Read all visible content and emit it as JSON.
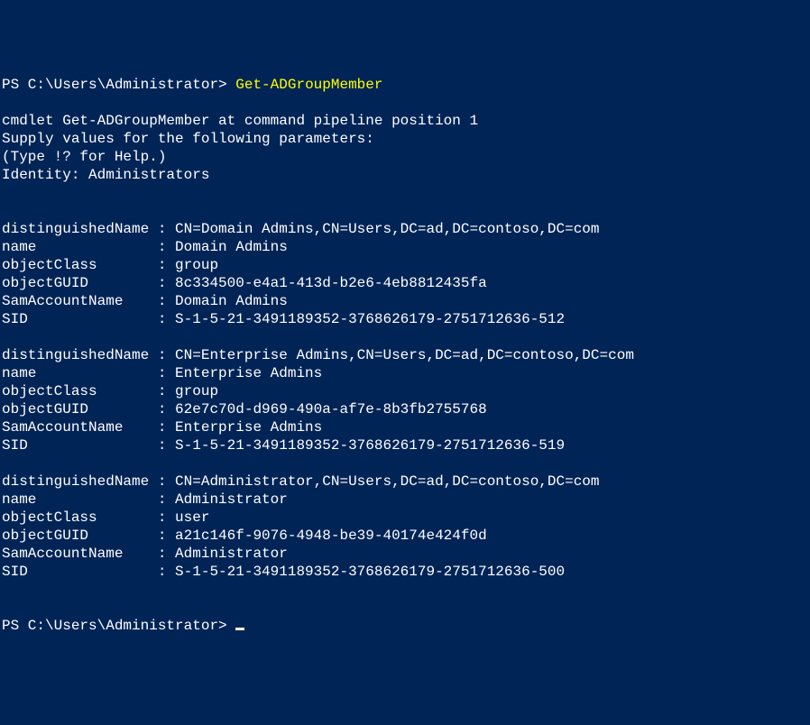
{
  "prompt1": {
    "ps": "PS C:\\Users\\Administrator> ",
    "cmd": "Get-ADGroupMember"
  },
  "header": {
    "line1": "cmdlet Get-ADGroupMember at command pipeline position 1",
    "line2": "Supply values for the following parameters:",
    "line3": "(Type !? for Help.)",
    "line4": "Identity: Administrators"
  },
  "records": [
    {
      "distinguishedName": "distinguishedName : CN=Domain Admins,CN=Users,DC=ad,DC=contoso,DC=com",
      "name": "name              : Domain Admins",
      "objectClass": "objectClass       : group",
      "objectGUID": "objectGUID        : 8c334500-e4a1-413d-b2e6-4eb8812435fa",
      "SamAccountName": "SamAccountName    : Domain Admins",
      "SID": "SID               : S-1-5-21-3491189352-3768626179-2751712636-512"
    },
    {
      "distinguishedName": "distinguishedName : CN=Enterprise Admins,CN=Users,DC=ad,DC=contoso,DC=com",
      "name": "name              : Enterprise Admins",
      "objectClass": "objectClass       : group",
      "objectGUID": "objectGUID        : 62e7c70d-d969-490a-af7e-8b3fb2755768",
      "SamAccountName": "SamAccountName    : Enterprise Admins",
      "SID": "SID               : S-1-5-21-3491189352-3768626179-2751712636-519"
    },
    {
      "distinguishedName": "distinguishedName : CN=Administrator,CN=Users,DC=ad,DC=contoso,DC=com",
      "name": "name              : Administrator",
      "objectClass": "objectClass       : user",
      "objectGUID": "objectGUID        : a21c146f-9076-4948-be39-40174e424f0d",
      "SamAccountName": "SamAccountName    : Administrator",
      "SID": "SID               : S-1-5-21-3491189352-3768626179-2751712636-500"
    }
  ],
  "prompt2": {
    "ps": "PS C:\\Users\\Administrator> "
  }
}
